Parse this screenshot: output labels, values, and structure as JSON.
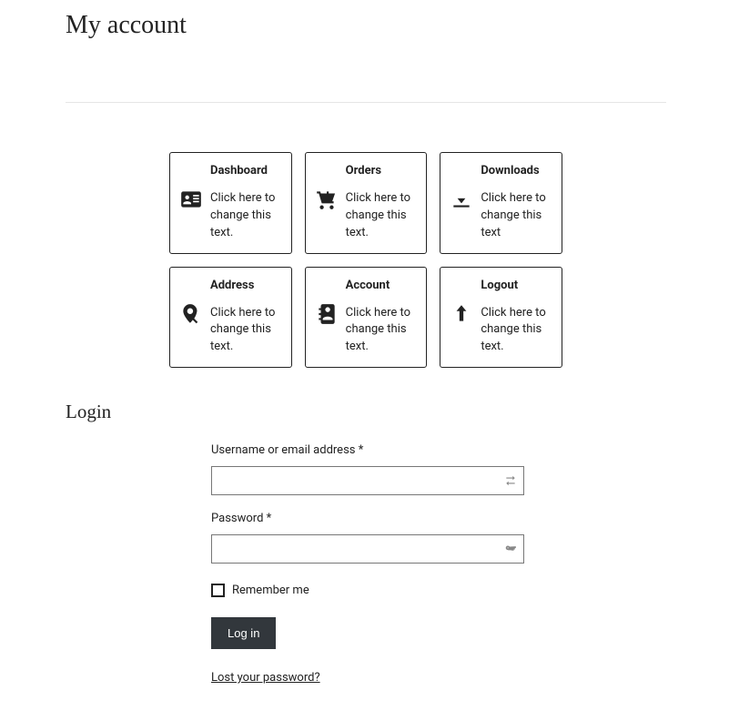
{
  "page_title": "My account",
  "cards": {
    "dashboard": {
      "title": "Dashboard",
      "desc": "Click here to change this text."
    },
    "orders": {
      "title": "Orders",
      "desc": "Click here to change this text."
    },
    "downloads": {
      "title": "Downloads",
      "desc": "Click here to change this text"
    },
    "address": {
      "title": "Address",
      "desc": "Click here to change this text."
    },
    "account": {
      "title": "Account",
      "desc": "Click here to change this text."
    },
    "logout": {
      "title": "Logout",
      "desc": "Click here to change this text."
    }
  },
  "login": {
    "heading": "Login",
    "username_label": "Username or email address *",
    "password_label": "Password *",
    "remember_label": "Remember me",
    "button_label": "Log in",
    "lost_password_label": "Lost your password?"
  }
}
